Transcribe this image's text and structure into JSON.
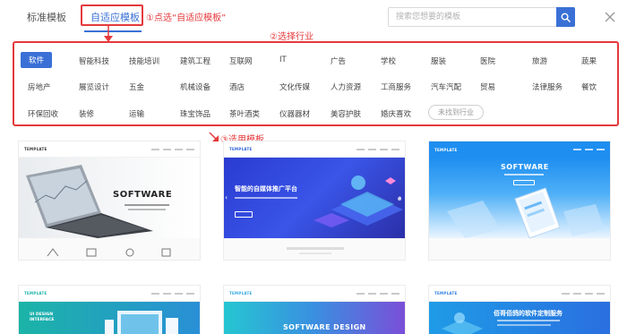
{
  "header": {
    "tabs": [
      {
        "label": "标准模板",
        "active": false
      },
      {
        "label": "自适应模板",
        "active": true
      }
    ],
    "search_placeholder": "搜索您想要的模板"
  },
  "annotations": {
    "step1": "①点选“自适应模板”",
    "step2": "②选择行业",
    "step3": "③选用模板"
  },
  "industries": {
    "row1": [
      "软件",
      "智能科技",
      "技能培训",
      "建筑工程",
      "互联网",
      "IT",
      "广告",
      "学校",
      "服装",
      "医院",
      "旅游",
      "蔬果"
    ],
    "row2": [
      "房地产",
      "展览设计",
      "五金",
      "机械设备",
      "酒店",
      "文化传媒",
      "人力资源",
      "工商服务",
      "汽车汽配",
      "贸易",
      "法律服务",
      "餐饮"
    ],
    "row3": [
      "环保回收",
      "装修",
      "运输",
      "珠宝饰品",
      "茶叶酒类",
      "仪器器材",
      "美容护肤",
      "婚庆喜欢"
    ],
    "selected": "软件",
    "not_found_label": "未找到行业"
  },
  "templates": [
    {
      "logo": "TEMPLATE",
      "hero_title": "SOFTWARE",
      "theme": "photo"
    },
    {
      "logo": "TEMPLATE",
      "hero_title": "智能的自媒体推广平台",
      "theme": "blue-dark"
    },
    {
      "logo": "TEMPLATE",
      "hero_title": "SOFTWARE",
      "theme": "blue-light"
    },
    {
      "logo": "TEMPLATE",
      "hero_title": "UI DESIGN INTERFACE",
      "theme": "teal"
    },
    {
      "logo": "TEMPLATE",
      "hero_title": "SOFTWARE DESIGN",
      "theme": "gradient"
    },
    {
      "logo": "TEMPLATE",
      "hero_title": "佰哥佰鸽的软件定制服务",
      "theme": "blue"
    }
  ],
  "colors": {
    "accent": "#3a70d6",
    "annotation": "#e4393c"
  }
}
